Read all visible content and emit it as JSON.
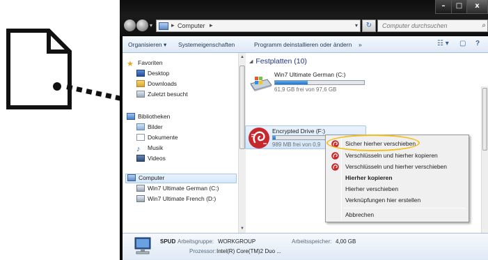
{
  "window": {
    "controls": [
      "–",
      "□",
      "x"
    ]
  },
  "addressbar": {
    "arrow": "▸",
    "crumb": "Computer",
    "crumb_arrow": "▸",
    "dropdown": "▾",
    "search_placeholder": "Computer durchsuchen",
    "refresh_glyph": "↻",
    "search_glyph": "⌕"
  },
  "toolbar": {
    "organize": "Organisieren ▾",
    "system_properties": "Systemeigenschaften",
    "uninstall": "Programm deinstallieren oder ändern",
    "more": "»",
    "view_glyph": "☷ ▾",
    "pane_glyph": "▢",
    "help_glyph": "?"
  },
  "navigation": {
    "favorites": {
      "header": "Favoriten",
      "items": [
        "Desktop",
        "Downloads",
        "Zuletzt besucht"
      ]
    },
    "libraries": {
      "header": "Bibliotheken",
      "items": [
        "Bilder",
        "Dokumente",
        "Musik",
        "Videos"
      ]
    },
    "computer": {
      "header": "Computer",
      "items": [
        "Win7 Ultimate German (C:)",
        "Win7 Ultimate French (D:)"
      ]
    }
  },
  "main": {
    "group_header": "Festplatten (10)",
    "drives": [
      {
        "name": "Win7 Ultimate German (C:)",
        "free": "61,9 GB frei von 97,6 GB",
        "used_fraction": 0.37
      },
      {
        "name": "Encrypted Drive (F:)",
        "free": "989 MB frei von 0,9",
        "used_fraction": 0.03
      }
    ]
  },
  "context_menu": {
    "items": [
      {
        "label": "Sicher hierher verschieben",
        "icon": "encrypt-icon",
        "bold": false
      },
      {
        "label": "Verschlüsseln und hierher kopieren",
        "icon": "encrypt-icon",
        "bold": false
      },
      {
        "label": "Verschlüsseln und hierher verschieben",
        "icon": "encrypt-icon",
        "bold": false
      },
      {
        "label": "Hierher kopieren",
        "icon": "",
        "bold": true
      },
      {
        "label": "Hierher verschieben",
        "icon": "",
        "bold": false
      },
      {
        "label": "Verknüpfungen hier erstellen",
        "icon": "",
        "bold": false
      },
      {
        "label": "Abbrechen",
        "icon": "",
        "bold": false
      }
    ]
  },
  "details": {
    "computer_name": "SPUD",
    "workgroup_label": "Arbeitsgruppe:",
    "workgroup_value": "WORKGROUP",
    "memory_label": "Arbeitsspeicher:",
    "memory_value": "4,00 GB",
    "processor_label": "Prozessor:",
    "processor_value": "Intel(R) Core(TM)2 Duo ..."
  },
  "colors": {
    "highlight_ellipse": "#f3c01e",
    "selection": "#d3e6fb",
    "group_header": "#1e3287",
    "bar_fill": "#1f72c9"
  }
}
